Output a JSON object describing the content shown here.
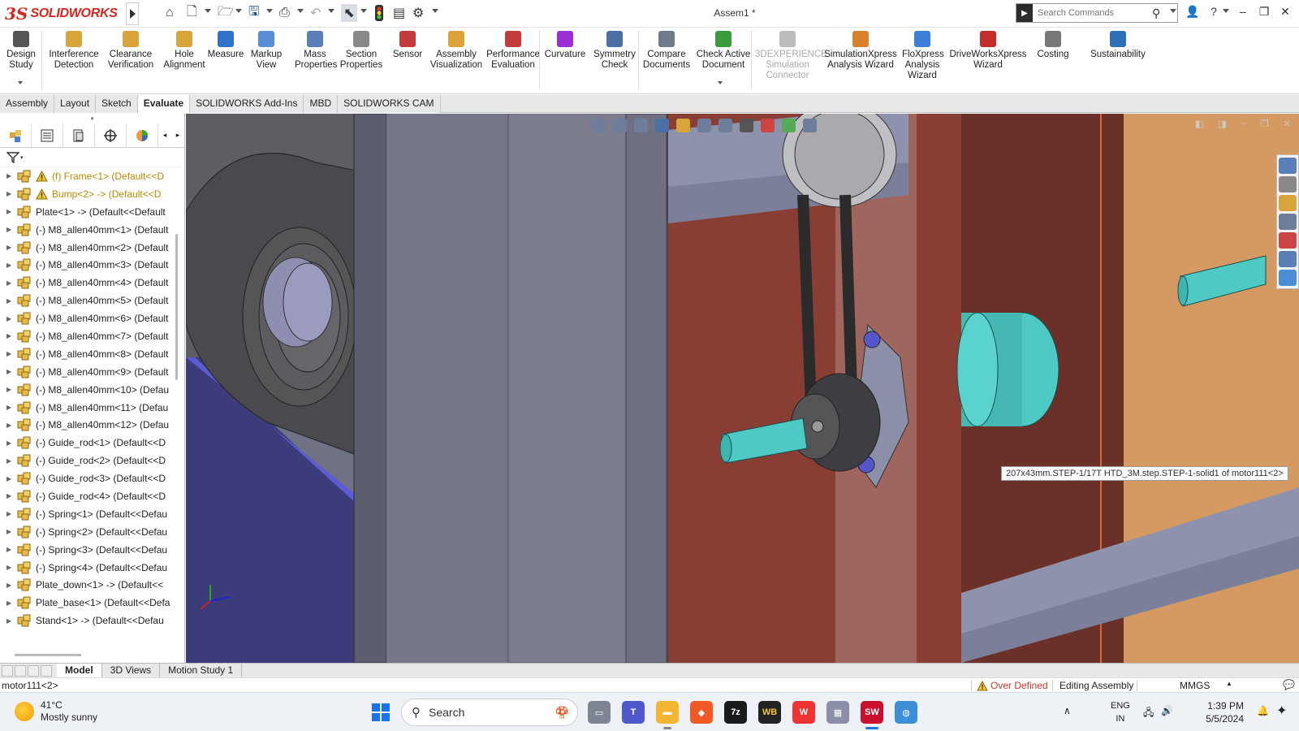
{
  "app": {
    "brand_symbol": "3S",
    "brand_name": "SOLIDWORKS",
    "document_title": "Assem1 *"
  },
  "search": {
    "placeholder": "Search Commands"
  },
  "ribbon": {
    "items": [
      {
        "label": "Design\nStudy",
        "icon": "design-study-icon",
        "color": "#555555"
      },
      {
        "label": "Interference\nDetection",
        "icon": "interference-icon",
        "color": "#d9a53b"
      },
      {
        "label": "Clearance\nVerification",
        "icon": "clearance-icon",
        "color": "#d9a53b"
      },
      {
        "label": "Hole\nAlignment",
        "icon": "hole-alignment-icon",
        "color": "#d9a53b"
      },
      {
        "label": "Measure",
        "icon": "measure-icon",
        "color": "#2f73c9"
      },
      {
        "label": "Markup\nView",
        "icon": "markup-icon",
        "color": "#5a8fd6"
      },
      {
        "label": "Mass\nProperties",
        "icon": "mass-properties-icon",
        "color": "#5b7fb5"
      },
      {
        "label": "Section\nProperties",
        "icon": "section-properties-icon",
        "color": "#888888"
      },
      {
        "label": "Sensor",
        "icon": "sensor-icon",
        "color": "#c43c3c"
      },
      {
        "label": "Assembly\nVisualization",
        "icon": "assembly-visualization-icon",
        "color": "#d9a53b"
      },
      {
        "label": "Performance\nEvaluation",
        "icon": "performance-icon",
        "color": "#c43c3c"
      },
      {
        "label": "Curvature",
        "icon": "curvature-icon",
        "color": "#9b30d9"
      },
      {
        "label": "Symmetry\nCheck",
        "icon": "symmetry-icon",
        "color": "#4a6fa5"
      },
      {
        "label": "Compare\nDocuments",
        "icon": "compare-icon",
        "color": "#6f7a8a"
      },
      {
        "label": "Check Active\nDocument",
        "icon": "check-document-icon",
        "color": "#3c9c3c"
      },
      {
        "label": "3DEXPERIENCE\nSimulation\nConnector",
        "icon": "simulation-connector-icon",
        "color": "#bbbbbb"
      },
      {
        "label": "SimulationXpress\nAnalysis Wizard",
        "icon": "simulationxpress-icon",
        "color": "#d9822b"
      },
      {
        "label": "FloXpress\nAnalysis\nWizard",
        "icon": "floxpress-icon",
        "color": "#3b7fd9"
      },
      {
        "label": "DriveWorksXpress\nWizard",
        "icon": "driveworks-icon",
        "color": "#c42b2b"
      },
      {
        "label": "Costing",
        "icon": "costing-icon",
        "color": "#777777"
      },
      {
        "label": "Sustainability",
        "icon": "sustainability-icon",
        "color": "#2f6fb5"
      }
    ]
  },
  "command_tabs": [
    "Assembly",
    "Layout",
    "Sketch",
    "Evaluate",
    "SOLIDWORKS Add-Ins",
    "MBD",
    "SOLIDWORKS CAM"
  ],
  "active_command_tab": "Evaluate",
  "feature_tree": {
    "items": [
      {
        "label": "(f) Frame<1> (Default<<D",
        "warning": true
      },
      {
        "label": "Bump<2> -> (Default<<D",
        "warning": true
      },
      {
        "label": "Plate<1> -> (Default<<Default",
        "warning": false
      },
      {
        "label": "(-) M8_allen40mm<1> (Default",
        "warning": false
      },
      {
        "label": "(-) M8_allen40mm<2> (Default",
        "warning": false
      },
      {
        "label": "(-) M8_allen40mm<3> (Default",
        "warning": false
      },
      {
        "label": "(-) M8_allen40mm<4> (Default",
        "warning": false
      },
      {
        "label": "(-) M8_allen40mm<5> (Default",
        "warning": false
      },
      {
        "label": "(-) M8_allen40mm<6> (Default",
        "warning": false
      },
      {
        "label": "(-) M8_allen40mm<7> (Default",
        "warning": false
      },
      {
        "label": "(-) M8_allen40mm<8> (Default",
        "warning": false
      },
      {
        "label": "(-) M8_allen40mm<9> (Default",
        "warning": false
      },
      {
        "label": "(-) M8_allen40mm<10> (Defau",
        "warning": false
      },
      {
        "label": "(-) M8_allen40mm<11> (Defau",
        "warning": false
      },
      {
        "label": "(-) M8_allen40mm<12> (Defau",
        "warning": false
      },
      {
        "label": "(-) Guide_rod<1> (Default<<D",
        "warning": false
      },
      {
        "label": "(-) Guide_rod<2> (Default<<D",
        "warning": false
      },
      {
        "label": "(-) Guide_rod<3> (Default<<D",
        "warning": false
      },
      {
        "label": "(-) Guide_rod<4> (Default<<D",
        "warning": false
      },
      {
        "label": "(-) Spring<1> (Default<<Defau",
        "warning": false
      },
      {
        "label": "(-) Spring<2> (Default<<Defau",
        "warning": false
      },
      {
        "label": "(-) Spring<3> (Default<<Defau",
        "warning": false
      },
      {
        "label": "(-) Spring<4> (Default<<Defau",
        "warning": false
      },
      {
        "label": "Plate_down<1> -> (Default<<",
        "warning": false
      },
      {
        "label": "Plate_base<1> (Default<<Defa",
        "warning": false
      },
      {
        "label": "Stand<1> -> (Default<<Defau",
        "warning": false
      }
    ]
  },
  "viewport": {
    "tooltip": "207x43mm.STEP-1/17T HTD_3M.step.STEP-1-solid1 of motor111<2>"
  },
  "model_tabs": [
    "Model",
    "3D Views",
    "Motion Study 1"
  ],
  "active_model_tab": "Model",
  "status": {
    "selection": "motor111<2>",
    "over_defined": "Over Defined",
    "mode": "Editing Assembly",
    "units": "MMGS"
  },
  "taskbar": {
    "weather_temp": "41°C",
    "weather_desc": "Mostly sunny",
    "search": "Search",
    "lang_1": "ENG",
    "lang_2": "IN",
    "time": "1:39 PM",
    "date": "5/5/2024"
  },
  "colors": {
    "accent_red": "#d8251d",
    "warning": "#b88a00",
    "teal_part": "#4fc9c4",
    "red_plate": "#8a3e33",
    "grey_frame": "#6f7285"
  }
}
